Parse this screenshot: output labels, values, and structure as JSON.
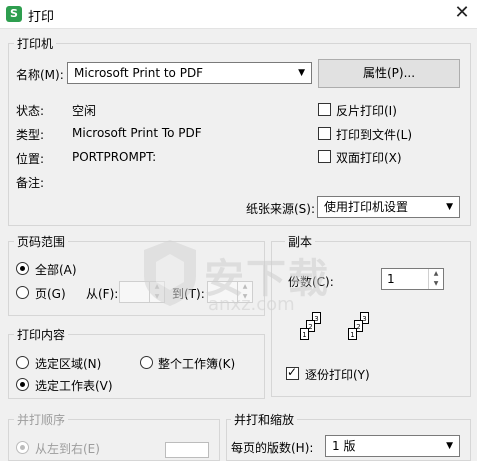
{
  "window": {
    "title": "打印",
    "app_icon": "S",
    "close_glyph": "✕"
  },
  "printer": {
    "legend": "打印机",
    "name_label": "名称(M):",
    "name_value": "Microsoft Print to PDF",
    "properties_button": "属性(P)...",
    "status_label": "状态:",
    "status_value": "空闲",
    "type_label": "类型:",
    "type_value": "Microsoft Print To PDF",
    "location_label": "位置:",
    "location_value": "PORTPROMPT:",
    "comment_label": "备注:",
    "reverse_print": {
      "label": "反片打印(I)",
      "checked": false
    },
    "print_to_file": {
      "label": "打印到文件(L)",
      "checked": false
    },
    "duplex": {
      "label": "双面打印(X)",
      "checked": false
    },
    "paper_source_label": "纸张来源(S):",
    "paper_source_value": "使用打印机设置"
  },
  "page_range": {
    "legend": "页码范围",
    "all": {
      "label": "全部(A)",
      "checked": true
    },
    "pages": {
      "label": "页(G)",
      "checked": false
    },
    "from_label": "从(F):",
    "to_label": "到(T):"
  },
  "copies": {
    "legend": "副本",
    "count_label": "份数(C):",
    "count_value": "1",
    "collate_label": "逐份打印(Y)",
    "collate_checked": true,
    "page_numbers": [
      "1",
      "2",
      "3"
    ]
  },
  "print_content": {
    "legend": "打印内容",
    "selection": {
      "label": "选定区域(N)",
      "checked": false
    },
    "workbook": {
      "label": "整个工作簿(K)",
      "checked": false
    },
    "sheet": {
      "label": "选定工作表(V)",
      "checked": true
    }
  },
  "print_order": {
    "legend": "并打顺序",
    "left_to_right": "从左到右(E)"
  },
  "scaling": {
    "legend": "并打和缩放",
    "pages_per_sheet_label": "每页的版数(H):",
    "pages_per_sheet_value": "1 版"
  },
  "watermark": {
    "text": "安下载",
    "subtext": "anxz.com"
  },
  "colors": {
    "accent": "#2e9e4f"
  }
}
